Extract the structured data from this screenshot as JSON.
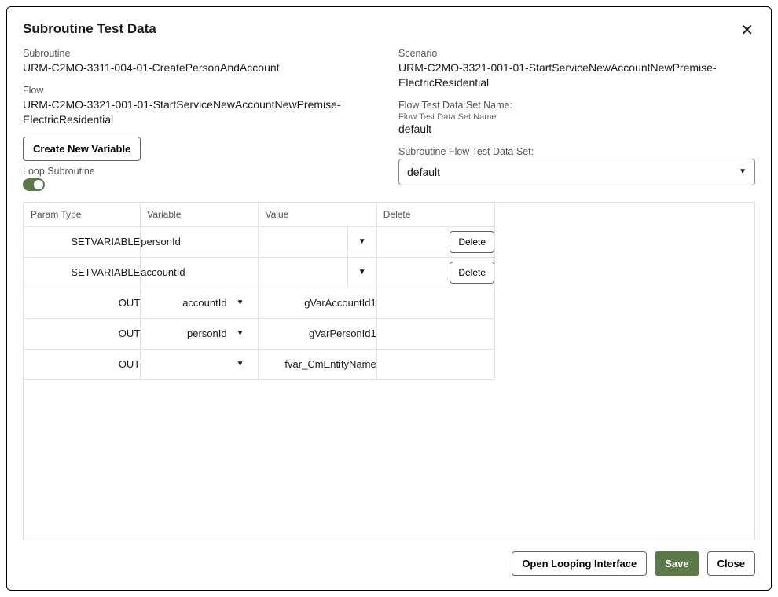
{
  "title": "Subroutine Test Data",
  "labels": {
    "subroutine": "Subroutine",
    "flow": "Flow",
    "loop": "Loop Subroutine",
    "scenario": "Scenario",
    "flowTestDataSetName": "Flow Test Data Set Name:",
    "flowTestDataSetNameSub": "Flow Test Data Set Name",
    "subroutineFlowTestDataSet": "Subroutine Flow Test Data Set:"
  },
  "values": {
    "subroutine": "URM-C2MO-3311-004-01-CreatePersonAndAccount",
    "flow": "URM-C2MO-3321-001-01-StartServiceNewAccountNewPremise-ElectricResidential",
    "scenario": "URM-C2MO-3321-001-01-StartServiceNewAccountNewPremise-ElectricResidential",
    "flowTestDataSetName": "default",
    "subroutineFlowTestDataSetSelected": "default"
  },
  "buttons": {
    "createNewVariable": "Create New Variable",
    "openLooping": "Open Looping Interface",
    "save": "Save",
    "close": "Close",
    "delete": "Delete"
  },
  "tableHeaders": {
    "paramType": "Param Type",
    "variable": "Variable",
    "value": "Value",
    "delete": "Delete"
  },
  "rows": [
    {
      "paramType": "SETVARIABLE",
      "variable": "personId",
      "variableDropdown": false,
      "value": "",
      "valueDropdown": true,
      "hasDelete": true
    },
    {
      "paramType": "SETVARIABLE",
      "variable": "accountId",
      "variableDropdown": false,
      "value": "",
      "valueDropdown": true,
      "hasDelete": true
    },
    {
      "paramType": "OUT",
      "variable": "accountId",
      "variableDropdown": true,
      "value": "gVarAccountId1",
      "valueDropdown": false,
      "hasDelete": false
    },
    {
      "paramType": "OUT",
      "variable": "personId",
      "variableDropdown": true,
      "value": "gVarPersonId1",
      "valueDropdown": false,
      "hasDelete": false
    },
    {
      "paramType": "OUT",
      "variable": "",
      "variableDropdown": true,
      "value": "fvar_CmEntityName",
      "valueDropdown": false,
      "hasDelete": false
    }
  ],
  "loopSubroutine": true
}
